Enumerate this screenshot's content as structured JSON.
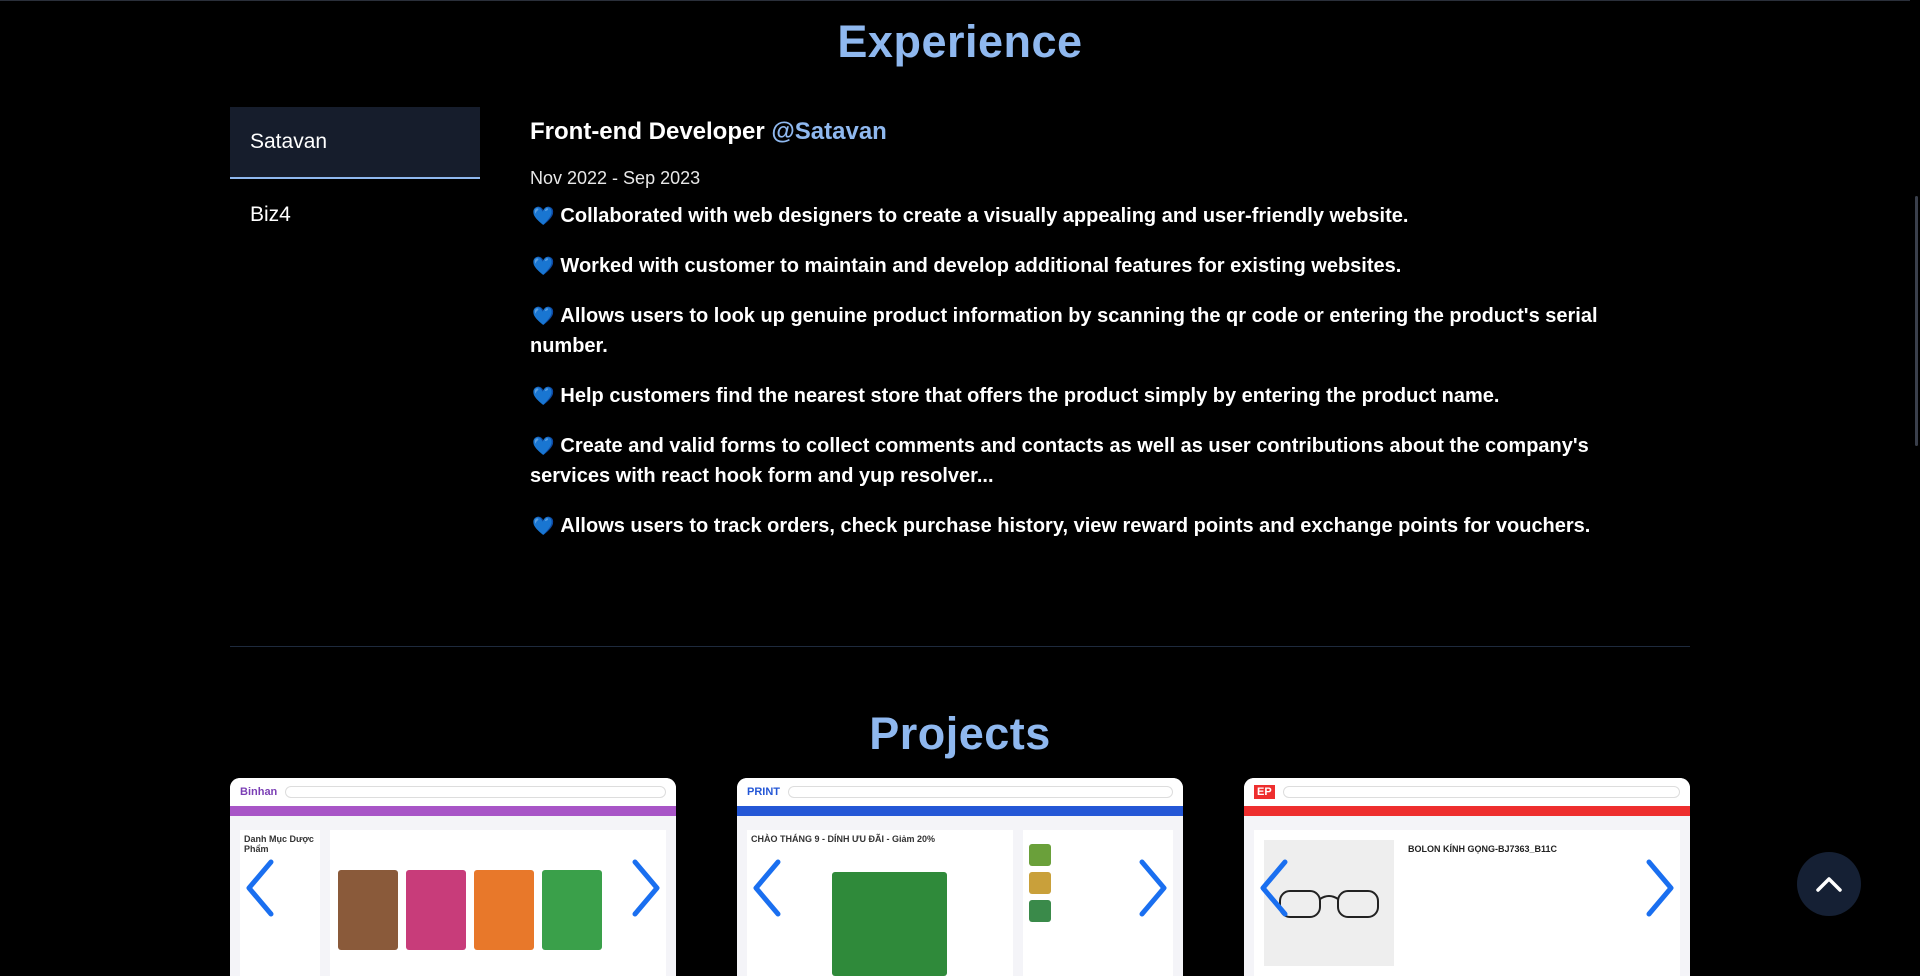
{
  "experience": {
    "title": "Experience",
    "tabs": [
      {
        "label": "Satavan",
        "active": true
      },
      {
        "label": "Biz4",
        "active": false
      }
    ],
    "job": {
      "role": "Front-end Developer",
      "company": "@Satavan",
      "dates": "Nov 2022 - Sep 2023",
      "duties": [
        "Collaborated with web designers to create a visually appealing and user-friendly website.",
        "Worked with customer to maintain and develop additional features for existing websites.",
        "Allows users to look up genuine product information by scanning the qr code or entering the product's serial number.",
        "Help customers find the nearest store that offers the product simply by entering the product name.",
        "Create and valid forms to collect comments and contacts as well as user contributions about the company's services with react hook form and yup resolver...",
        "Allows users to track orders, check purchase history, view reward points and exchange points for vouchers."
      ]
    }
  },
  "projects": {
    "title": "Projects",
    "cards": [
      {
        "logo": "Binhan",
        "bar_color": "#a855c7",
        "screenshot_caption": "Danh Mục Dược Phẩm"
      },
      {
        "logo": "PRINT",
        "bar_color": "#2457d6",
        "screenshot_caption": "CHÀO THÁNG 9 - DÍNH ƯU ĐÃI - Giảm 20%"
      },
      {
        "logo": "EP",
        "bar_color": "#ee2e2e",
        "screenshot_caption": "BOLON KÍNH GỌNG-BJ7363_B11C"
      }
    ]
  },
  "colors": {
    "accent": "#8fb8ef",
    "arrow": "#1a6ff0",
    "heart": "#1f8ff0"
  },
  "icons": {
    "scroll_top": "chevron-up-icon",
    "prev": "chevron-left-icon",
    "next": "chevron-right-icon",
    "bullet": "blue-heart-icon"
  }
}
